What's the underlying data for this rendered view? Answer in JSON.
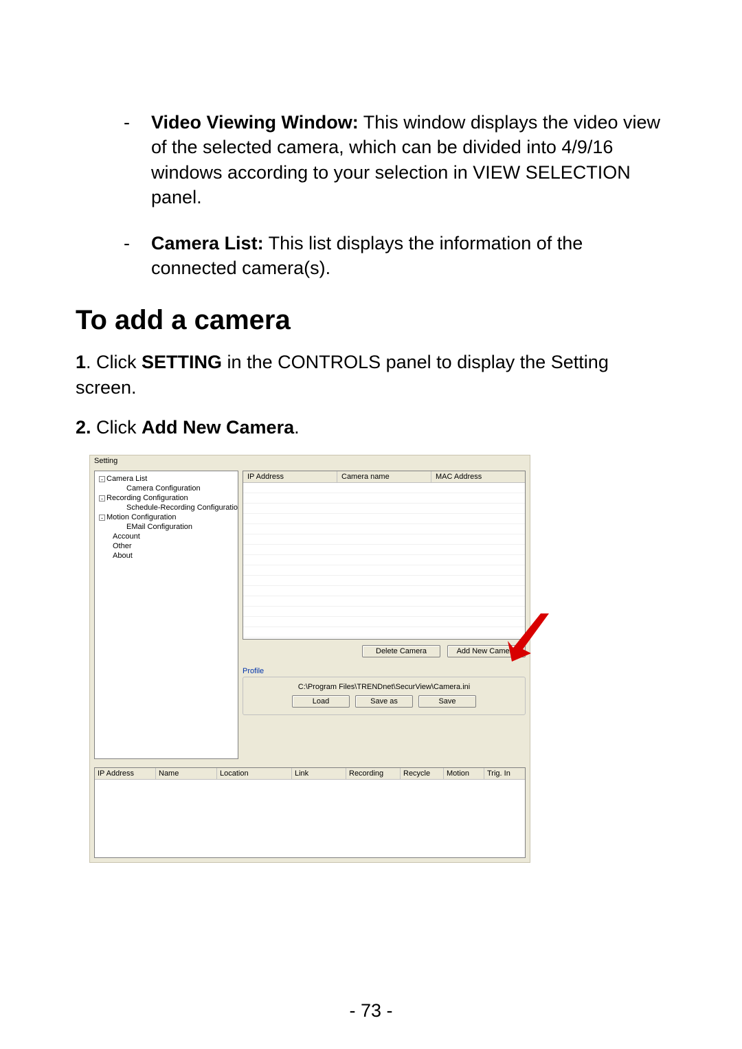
{
  "bullets": {
    "b1_bold": "Video Viewing Window:",
    "b1_text": " This window displays the video view of the selected camera, which can be divided into 4/9/16 windows according to your selection in VIEW SELECTION panel.",
    "b2_bold": "Camera List:",
    "b2_text": " This list displays the information of the connected camera(s)."
  },
  "heading": "To add a camera",
  "steps": {
    "s1_num": "1",
    "s1_pre": ".   Click ",
    "s1_bold": "SETTING",
    "s1_post": " in the CONTROLS panel to display the Setting screen.",
    "s2_num": "2.",
    "s2_pre": "   Click ",
    "s2_bold": "Add New Camera",
    "s2_post": "."
  },
  "screenshot": {
    "title": "Setting",
    "tree": {
      "n1": "Camera List",
      "n1a": "Camera Configuration",
      "n2": "Recording Configuration",
      "n2a": "Schedule-Recording Configuration",
      "n3": "Motion Configuration",
      "n3a": "EMail Configuration",
      "n4": "Account",
      "n5": "Other",
      "n6": "About"
    },
    "cam_headers": {
      "h1": "IP Address",
      "h2": "Camera name",
      "h3": "MAC Address"
    },
    "buttons": {
      "delete": "Delete Camera",
      "add": "Add New Camera",
      "load": "Load",
      "saveas": "Save as",
      "save": "Save"
    },
    "profile_label": "Profile",
    "profile_path": "C:\\Program Files\\TRENDnet\\SecurView\\Camera.ini",
    "status_headers": {
      "h1": "IP Address",
      "h2": "Name",
      "h3": "Location",
      "h4": "Link",
      "h5": "Recording",
      "h6": "Recycle",
      "h7": "Motion",
      "h8": "Trig. In"
    }
  },
  "page_number": "- 73 -"
}
